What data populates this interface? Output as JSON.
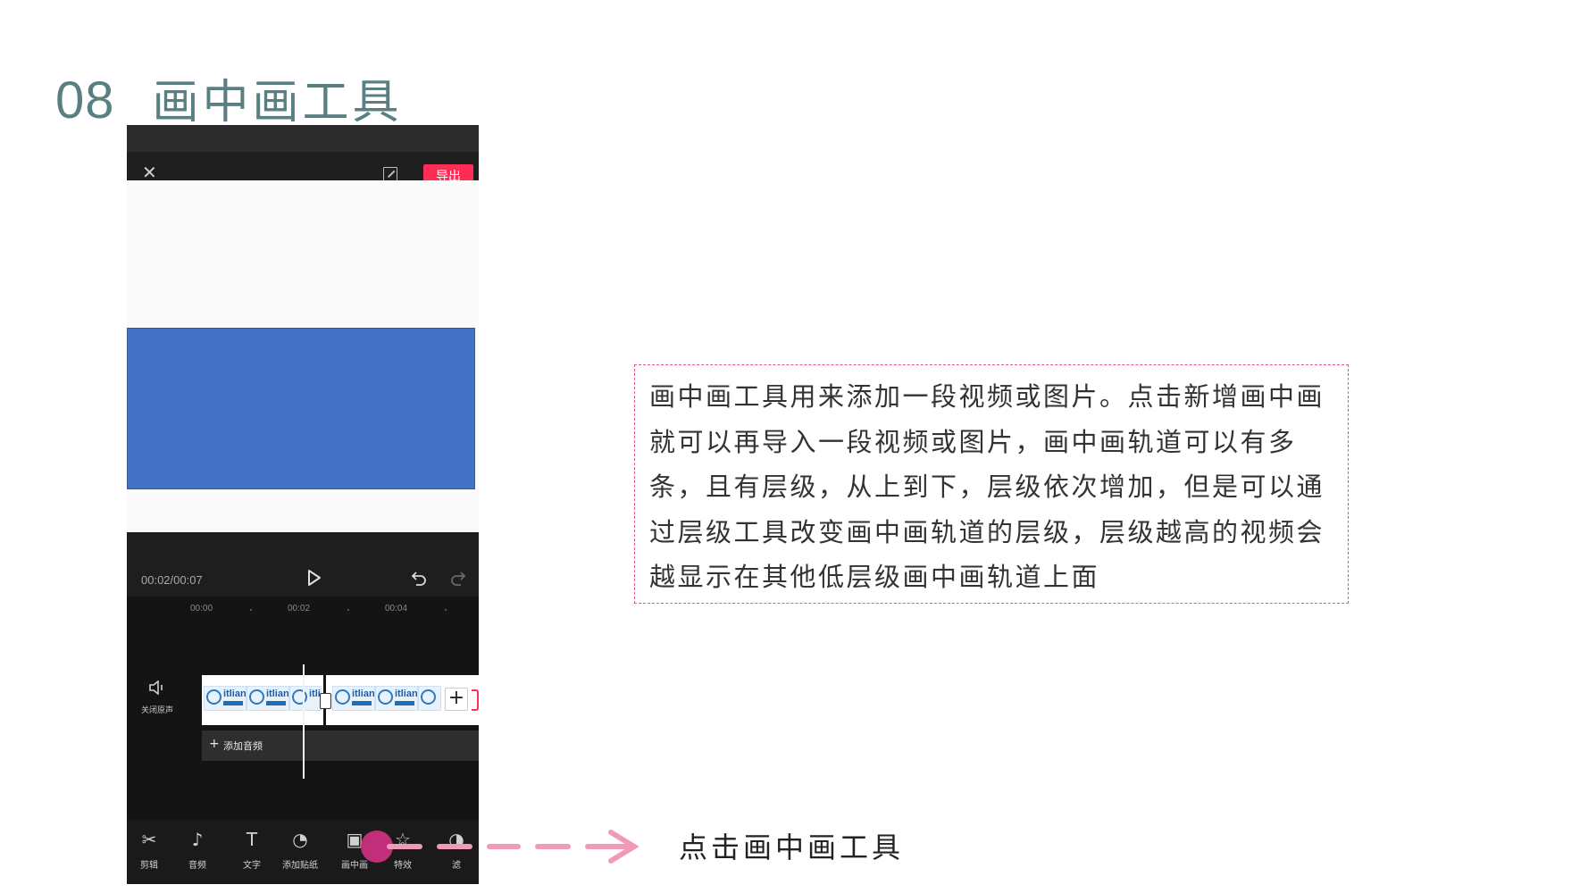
{
  "slide": {
    "number": "08",
    "title": "画中画工具"
  },
  "phone": {
    "export_label": "导出",
    "timecode": "00:02/00:07",
    "ruler": [
      "00:00",
      "00:02",
      "00:04"
    ],
    "mute_label": "关闭原声",
    "clip_brand": "itlian",
    "add_clip_symbol": "+",
    "add_audio_label": "添加音频",
    "toolbar": [
      {
        "icon": "scissors-icon",
        "glyph": "✂",
        "label": "剪辑"
      },
      {
        "icon": "music-note-icon",
        "glyph": "♪",
        "label": "音频"
      },
      {
        "icon": "text-icon",
        "glyph": "T",
        "label": "文字"
      },
      {
        "icon": "sticker-icon",
        "glyph": "◔",
        "label": "添加贴纸"
      },
      {
        "icon": "picture-in-picture-icon",
        "glyph": "▣",
        "label": "画中画"
      },
      {
        "icon": "effects-star-icon",
        "glyph": "☆",
        "label": "特效"
      },
      {
        "icon": "filter-icon",
        "glyph": "◑",
        "label": "滤"
      }
    ]
  },
  "description": "画中画工具用来添加一段视频或图片。点击新增画中画就可以再导入一段视频或图片，画中画轨道可以有多条，且有层级，从上到下，层级依次增加，但是可以通过层级工具改变画中画轨道的层级，层级越高的视频会越显示在其他低层级画中画轨道上面",
  "hint": "点击画中画工具",
  "colors": {
    "title": "#5a7f82",
    "export": "#ff2c55",
    "preview_rect": "#4472c4",
    "arrow": "#f19ab8",
    "highlight": "#c12f7a",
    "box_border": "#e25a7a"
  }
}
